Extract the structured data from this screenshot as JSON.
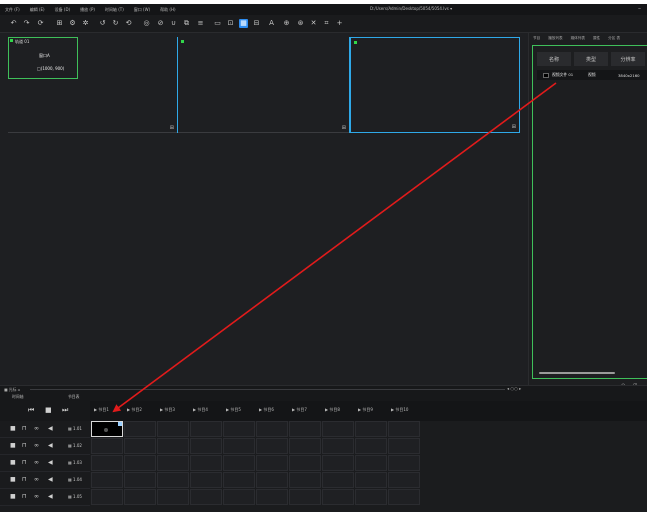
{
  "menu": [
    "文件 (F)",
    "编辑 (E)",
    "设备 (D)",
    "播放 (P)",
    "时间轴 (T)",
    "窗口 (W)",
    "帮助 (H)"
  ],
  "window_path": "D:/Users/Admin/Desktop/5054/5054.lvs  ▾",
  "toolbar_icons": [
    "undo-icon",
    "redo-icon",
    "refresh-icon",
    "grid-icon",
    "settings-icon",
    "gear-icon",
    "rotate-left-icon",
    "rotate-right-icon",
    "loop-icon",
    "target-icon",
    "record-icon",
    "magnet-icon",
    "layers-icon",
    "list-icon",
    "display-icon",
    "window-icon",
    "grid-active-icon",
    "monitor-icon",
    "text-icon",
    "expand-icon",
    "filter-icon",
    "cut-icon",
    "crop-icon",
    "add-icon"
  ],
  "stage": {
    "layer_label": "轨道 01",
    "layer_title": "窗口A",
    "layer_coords": "□(1000, 900)",
    "corner_icon": "⊞"
  },
  "right_panel": {
    "tabs": [
      "节目",
      "播放列表",
      "媒体列表",
      "属性",
      "分区 表"
    ],
    "headers": [
      "名称",
      "类型",
      "分辨率"
    ],
    "row": {
      "name": "视频文件 01",
      "type": "视频",
      "resolution": "3840x2160"
    },
    "bottom_icons": [
      "⊙",
      "⊞"
    ]
  },
  "status": {
    "left": "■ 光标 ◂",
    "right": "◂ ○○ ▸"
  },
  "bottom_tabs": [
    "时间轴",
    "节目表"
  ],
  "transport": [
    "⏮",
    "■",
    "⏭"
  ],
  "programs": [
    "▶ 节目1",
    "▶ 节目2",
    "▶ 节目3",
    "▶ 节目4",
    "▶ 节目5",
    "▶ 节目6",
    "▶ 节目7",
    "▶ 节目8",
    "▶ 节目9",
    "▶ 节目10"
  ],
  "tracks": [
    "▦ 1.01",
    "▦ 1.02",
    "▦ 1.03",
    "▦ 1.04",
    "▦ 1.05"
  ],
  "colors": {
    "accent": "#2d8cf0",
    "selection_green": "#3fbf5a",
    "arrow": "#e11b1b",
    "screen_blue": "#2fa8e8"
  }
}
